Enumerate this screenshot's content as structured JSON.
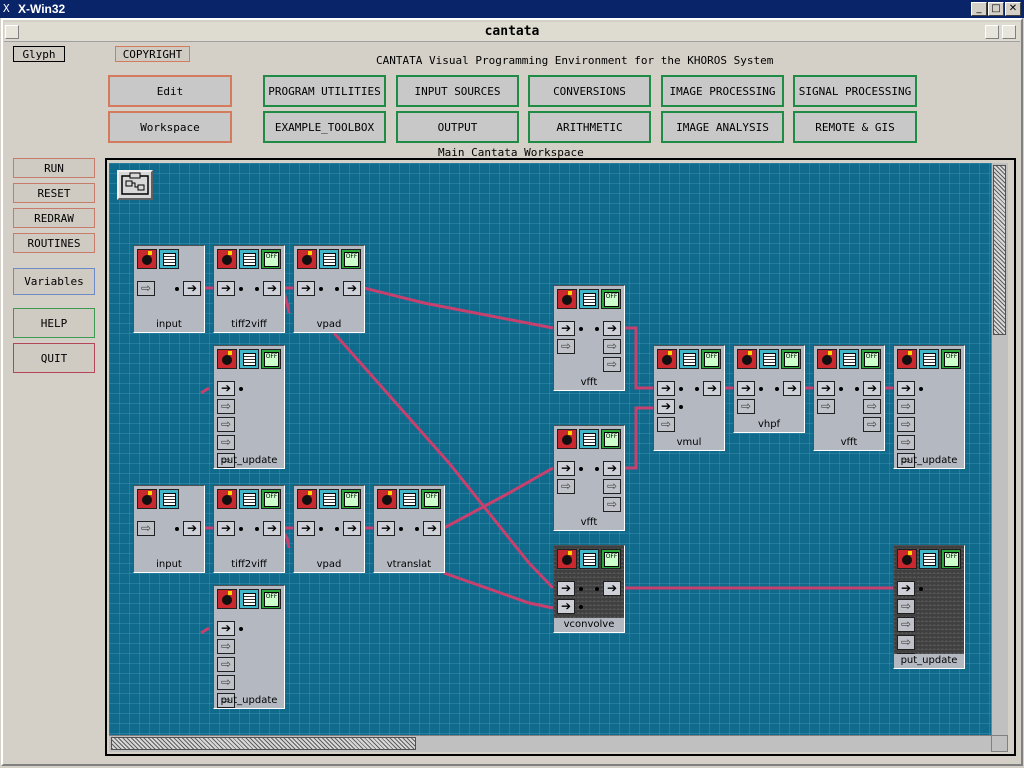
{
  "xwin": {
    "title": "X-Win32",
    "logo": "X",
    "btn_min": "_",
    "btn_max": "□",
    "btn_close": "✕"
  },
  "app": {
    "title": "cantata",
    "subtitle": "CANTATA Visual Programming Environment for the KHOROS System"
  },
  "top": {
    "glyph": "Glyph",
    "copyright": "COPYRIGHT",
    "edit": "Edit",
    "workspace": "Workspace"
  },
  "toolboxes": {
    "row1": [
      "PROGRAM UTILITIES",
      "INPUT SOURCES",
      "CONVERSIONS",
      "IMAGE PROCESSING",
      "SIGNAL PROCESSING"
    ],
    "row2": [
      "EXAMPLE_TOOLBOX",
      "OUTPUT",
      "ARITHMETIC",
      "IMAGE ANALYSIS",
      "REMOTE & GIS"
    ]
  },
  "sidebar": {
    "run": "RUN",
    "reset": "RESET",
    "redraw": "REDRAW",
    "routines": "ROUTINES",
    "variables": "Variables",
    "help": "HELP",
    "quit": "QUIT"
  },
  "workspace": {
    "label": "Main Cantata Workspace"
  },
  "icons": {
    "off": "OFF",
    "arrow": "➔",
    "opt_arrow": "⇨"
  },
  "nodes": {
    "n1": "input",
    "n2": "tiff2viff",
    "n3": "vpad",
    "n4": "put_update",
    "n5": "vfft",
    "n6": "vmul",
    "n7": "vhpf",
    "n8": "vfft",
    "n9": "put_update",
    "n10": "vfft",
    "n11": "input",
    "n12": "tiff2viff",
    "n13": "vpad",
    "n14": "vtranslat",
    "n15": "put_update",
    "n16": "vconvolve",
    "n17": "put_update"
  },
  "colors": {
    "canvas": "#0f6a8c",
    "wire": "#c8406e",
    "toolbox_border": "#1e8c45",
    "edit_border": "#d47b5e"
  }
}
